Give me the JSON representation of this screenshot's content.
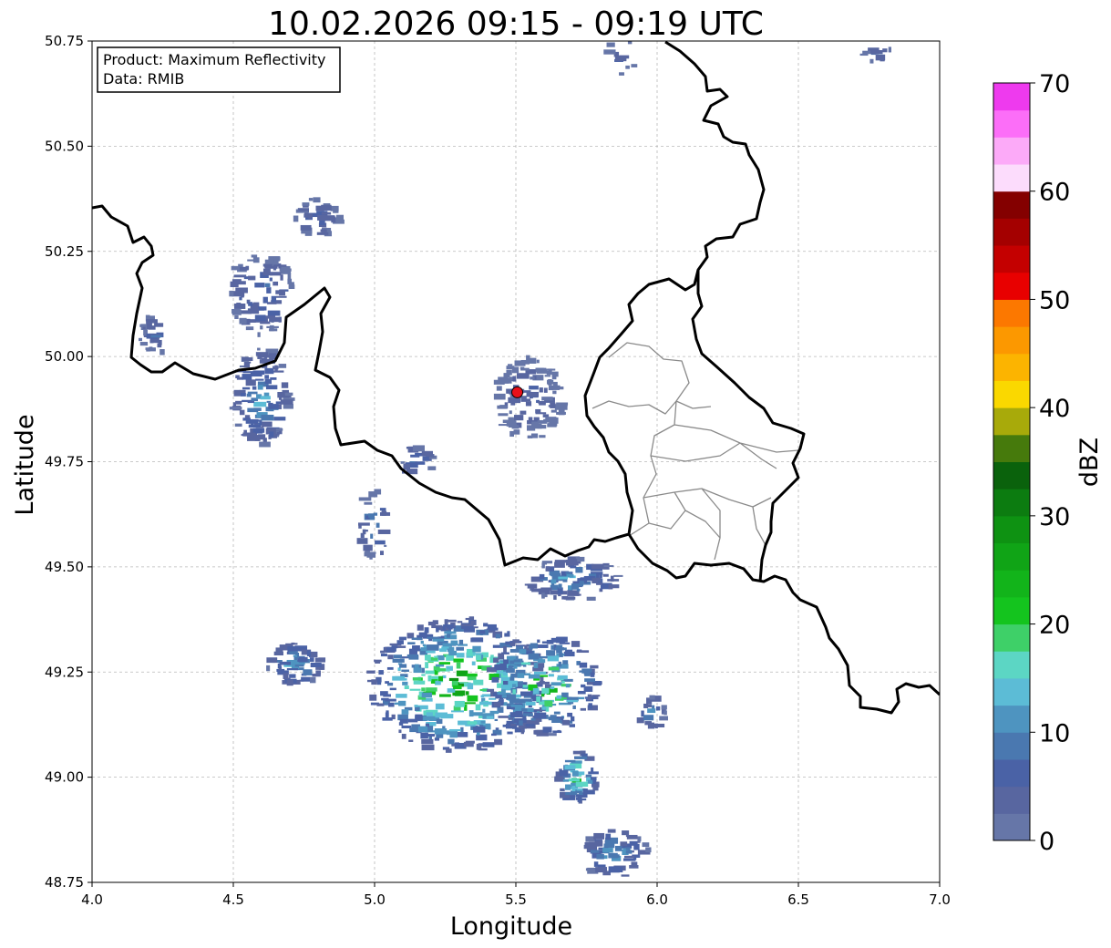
{
  "title": "10.02.2026 09:15 - 09:19 UTC",
  "info_box": {
    "product_line": "Product: Maximum Reflectivity",
    "data_line": "Data: RMIB"
  },
  "axes": {
    "xlabel": "Longitude",
    "ylabel": "Latitude",
    "xlim": [
      4.0,
      7.0
    ],
    "ylim": [
      48.75,
      50.75
    ],
    "x_ticks": [
      "4.0",
      "4.5",
      "5.0",
      "5.5",
      "6.0",
      "6.5",
      "7.0"
    ],
    "y_ticks": [
      "50.75",
      "50.50",
      "50.25",
      "50.00",
      "49.75",
      "49.50",
      "49.25",
      "49.00",
      "48.75"
    ],
    "grid": true
  },
  "radar_site": {
    "lon": 5.505,
    "lat": 49.915,
    "color": "#e8101a"
  },
  "colorbar": {
    "label": "dBZ",
    "ticks": [
      "0",
      "10",
      "20",
      "30",
      "40",
      "50",
      "60",
      "70"
    ],
    "range": [
      0,
      70
    ],
    "step": 2.5,
    "colors": [
      "#6676a8",
      "#5866a0",
      "#4a62a6",
      "#4a78b0",
      "#4e94c0",
      "#5cbcd6",
      "#5cd6c4",
      "#3ed068",
      "#14c41e",
      "#12b41a",
      "#10a416",
      "#0e9212",
      "#0c7c10",
      "#0a620c",
      "#467a0c",
      "#a8aa0a",
      "#fad800",
      "#fcb400",
      "#fc9800",
      "#fc7800",
      "#e80000",
      "#c40000",
      "#a40000",
      "#840000",
      "#fcdcfc",
      "#fcaaf8",
      "#fc6ef8",
      "#ee3aee"
    ]
  },
  "chart_data": {
    "type": "heatmap",
    "title": "10.02.2026 09:15 - 09:19 UTC",
    "xlabel": "Longitude",
    "ylabel": "Latitude",
    "xlim": [
      4.0,
      7.0
    ],
    "ylim": [
      48.75,
      50.75
    ],
    "colorbar_label": "dBZ",
    "colorbar_range": [
      0,
      70
    ],
    "precip_areas": [
      {
        "lon": 5.3,
        "lat": 49.22,
        "dlon": 0.32,
        "dlat": 0.16,
        "peak_dbz": 28,
        "count": 420
      },
      {
        "lon": 5.6,
        "lat": 49.22,
        "dlon": 0.2,
        "dlat": 0.12,
        "peak_dbz": 26,
        "count": 200
      },
      {
        "lon": 5.72,
        "lat": 49.0,
        "dlon": 0.07,
        "dlat": 0.06,
        "peak_dbz": 24,
        "count": 60
      },
      {
        "lon": 5.85,
        "lat": 48.82,
        "dlon": 0.12,
        "dlat": 0.06,
        "peak_dbz": 14,
        "count": 60
      },
      {
        "lon": 5.7,
        "lat": 49.47,
        "dlon": 0.17,
        "dlat": 0.05,
        "peak_dbz": 14,
        "count": 90
      },
      {
        "lon": 4.6,
        "lat": 49.9,
        "dlon": 0.1,
        "dlat": 0.12,
        "peak_dbz": 14,
        "count": 120
      },
      {
        "lon": 4.6,
        "lat": 50.15,
        "dlon": 0.12,
        "dlat": 0.1,
        "peak_dbz": 10,
        "count": 90
      },
      {
        "lon": 4.72,
        "lat": 49.27,
        "dlon": 0.1,
        "dlat": 0.05,
        "peak_dbz": 16,
        "count": 60
      },
      {
        "lon": 4.8,
        "lat": 50.33,
        "dlon": 0.08,
        "dlat": 0.05,
        "peak_dbz": 8,
        "count": 40
      },
      {
        "lon": 4.22,
        "lat": 50.05,
        "dlon": 0.05,
        "dlat": 0.05,
        "peak_dbz": 8,
        "count": 30
      },
      {
        "lon": 5.0,
        "lat": 49.6,
        "dlon": 0.06,
        "dlat": 0.08,
        "peak_dbz": 12,
        "count": 30
      },
      {
        "lon": 5.15,
        "lat": 49.75,
        "dlon": 0.06,
        "dlat": 0.04,
        "peak_dbz": 10,
        "count": 20
      },
      {
        "lon": 5.98,
        "lat": 49.15,
        "dlon": 0.05,
        "dlat": 0.04,
        "peak_dbz": 14,
        "count": 20
      },
      {
        "lon": 5.55,
        "lat": 49.9,
        "dlon": 0.12,
        "dlat": 0.1,
        "peak_dbz": 6,
        "count": 120
      },
      {
        "lon": 5.88,
        "lat": 50.72,
        "dlon": 0.05,
        "dlat": 0.05,
        "peak_dbz": 8,
        "count": 10
      },
      {
        "lon": 6.78,
        "lat": 50.72,
        "dlon": 0.05,
        "dlat": 0.02,
        "peak_dbz": 8,
        "count": 12
      }
    ]
  }
}
